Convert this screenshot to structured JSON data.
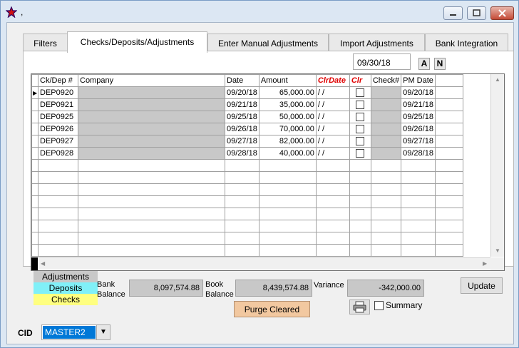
{
  "window": {
    "title": ","
  },
  "tabs": [
    {
      "label": "Filters"
    },
    {
      "label": "Checks/Deposits/Adjustments"
    },
    {
      "label": "Enter Manual Adjustments"
    },
    {
      "label": "Import Adjustments"
    },
    {
      "label": "Bank Integration"
    }
  ],
  "toolbar": {
    "date": "09/30/18",
    "btn_a": "A",
    "btn_n": "N"
  },
  "grid": {
    "headers": [
      "Ck/Dep #",
      "Company",
      "Date",
      "Amount",
      "ClrDate",
      "Clr",
      "Check#",
      "PM Date"
    ],
    "rows": [
      {
        "id": "DEP0920",
        "company": "",
        "date": "09/20/18",
        "amount": "65,000.00",
        "clrdate": "/ /",
        "check": "",
        "pmdate": "09/20/18"
      },
      {
        "id": "DEP0921",
        "company": "",
        "date": "09/21/18",
        "amount": "35,000.00",
        "clrdate": "/ /",
        "check": "",
        "pmdate": "09/21/18"
      },
      {
        "id": "DEP0925",
        "company": "",
        "date": "09/25/18",
        "amount": "50,000.00",
        "clrdate": "/ /",
        "check": "",
        "pmdate": "09/25/18"
      },
      {
        "id": "DEP0926",
        "company": "",
        "date": "09/26/18",
        "amount": "70,000.00",
        "clrdate": "/ /",
        "check": "",
        "pmdate": "09/26/18"
      },
      {
        "id": "DEP0927",
        "company": "",
        "date": "09/27/18",
        "amount": "82,000.00",
        "clrdate": "/ /",
        "check": "",
        "pmdate": "09/27/18"
      },
      {
        "id": "DEP0928",
        "company": "",
        "date": "09/28/18",
        "amount": "40,000.00",
        "clrdate": "/ /",
        "check": "",
        "pmdate": "09/28/18"
      }
    ]
  },
  "legend": {
    "adjustments": "Adjustments",
    "deposits": "Deposits",
    "checks": "Checks",
    "colors": {
      "adjustments": "#c8c8c8",
      "deposits": "#80f0f8",
      "checks": "#ffff80"
    }
  },
  "summary": {
    "bank_label_1": "Bank",
    "bank_label_2": "Balance",
    "bank_balance": "8,097,574.88",
    "book_label_1": "Book",
    "book_label_2": "Balance",
    "book_balance": "8,439,574.88",
    "variance_label": "Variance",
    "variance": "-342,000.00"
  },
  "buttons": {
    "update": "Update",
    "purge": "Purge Cleared",
    "summary_label": "Summary",
    "print_icon": "printer-icon"
  },
  "cid": {
    "label": "CID",
    "value": "MASTER2"
  }
}
